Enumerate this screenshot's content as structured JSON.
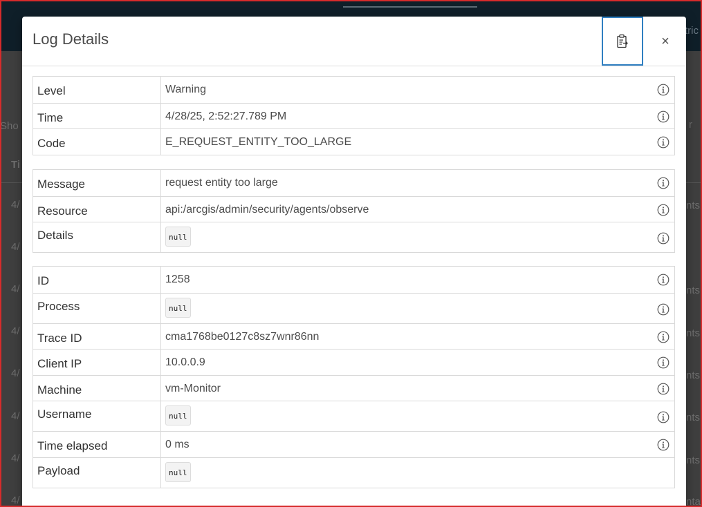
{
  "background": {
    "topbar_right_text": "tric",
    "side_texts": [
      "Sho",
      "Ti",
      "4/",
      "4/",
      "4/",
      "4/",
      "4/",
      "4/",
      "4/",
      "4/"
    ],
    "right_texts": [
      "r",
      "nts",
      "nts",
      "nts",
      "nts",
      "nts",
      "nts",
      "nta",
      "nts"
    ]
  },
  "modal": {
    "title": "Log Details",
    "copy_button_label": "Copy to clipboard",
    "close_glyph": "×"
  },
  "groups": [
    {
      "rows": [
        {
          "label": "Level",
          "value": "Warning",
          "is_null": false,
          "info": true
        },
        {
          "label": "Time",
          "value": "4/28/25, 2:52:27.789 PM",
          "is_null": false,
          "info": true
        },
        {
          "label": "Code",
          "value": "E_REQUEST_ENTITY_TOO_LARGE",
          "is_null": false,
          "info": true
        }
      ]
    },
    {
      "rows": [
        {
          "label": "Message",
          "value": "request entity too large",
          "is_null": false,
          "info": true
        },
        {
          "label": "Resource",
          "value": "api:/arcgis/admin/security/agents/observe",
          "is_null": false,
          "info": true
        },
        {
          "label": "Details",
          "value": "null",
          "is_null": true,
          "info": true
        }
      ]
    },
    {
      "rows": [
        {
          "label": "ID",
          "value": "1258",
          "is_null": false,
          "info": true
        },
        {
          "label": "Process",
          "value": "null",
          "is_null": true,
          "info": true
        },
        {
          "label": "Trace ID",
          "value": "cma1768be0127c8sz7wnr86nn",
          "is_null": false,
          "info": true
        },
        {
          "label": "Client IP",
          "value": "10.0.0.9",
          "is_null": false,
          "info": true
        },
        {
          "label": "Machine",
          "value": "vm-Monitor",
          "is_null": false,
          "info": true
        },
        {
          "label": "Username",
          "value": "null",
          "is_null": true,
          "info": true
        },
        {
          "label": "Time elapsed",
          "value": "0 ms",
          "is_null": false,
          "info": true
        },
        {
          "label": "Payload",
          "value": "null",
          "is_null": true,
          "info": false
        }
      ]
    }
  ],
  "colors": {
    "focus_border": "#2f7fc1",
    "frame_border": "#d62b2b",
    "backdrop": "#3f3f3f"
  }
}
